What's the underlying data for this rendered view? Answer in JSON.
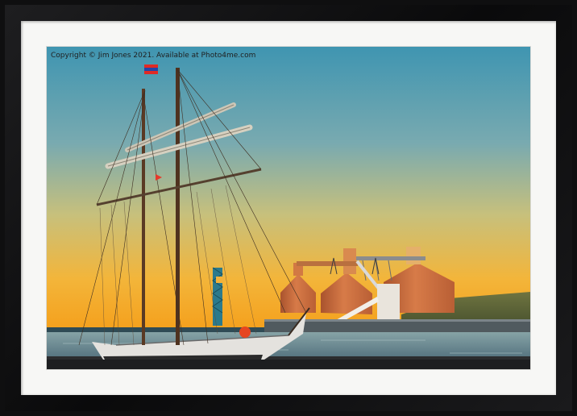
{
  "photo": {
    "watermark": "Copyright © Jim Jones 2021. Available at Photo4me.com"
  },
  "colors": {
    "frame": "#0f0f10",
    "mount": "#f7f7f5",
    "sky_top": "#4d9bb2",
    "sky_mid": "#c9c27a",
    "sky_horizon": "#f6a61b",
    "silo": "#c86a3c",
    "water": "#6f8f98"
  }
}
